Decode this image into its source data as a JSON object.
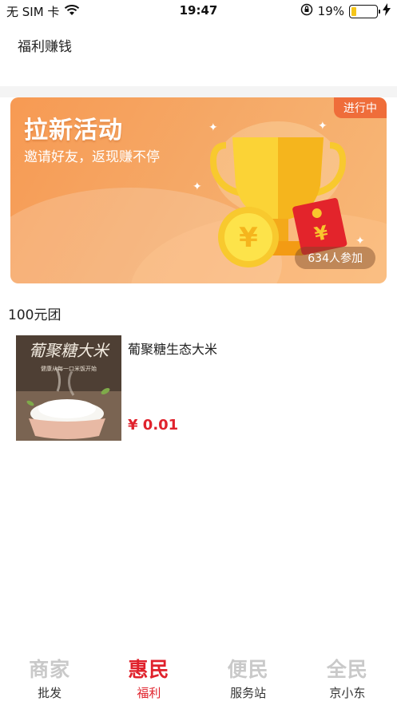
{
  "status_bar": {
    "carrier": "无 SIM 卡",
    "time": "19:47",
    "battery_percent": "19%",
    "battery_level": 0.19,
    "battery_color": "#f5c518"
  },
  "header": {
    "title": "福利赚钱"
  },
  "banner": {
    "title": "拉新活动",
    "subtitle": "邀请好友，返现赚不停",
    "status_tag": "进行中",
    "participants": "634人参加",
    "coin_symbol": "¥",
    "accent_color": "#f79a53"
  },
  "section": {
    "title": "100元团"
  },
  "product": {
    "name": "葡聚糖生态大米",
    "price": "¥ 0.01",
    "image_title": "葡聚糖大米",
    "image_subtitle": "健康从每一口米饭开始"
  },
  "tabs": [
    {
      "icon_text": "商家",
      "label": "批发",
      "active": false
    },
    {
      "icon_text": "惠民",
      "label": "福利",
      "active": true
    },
    {
      "icon_text": "便民",
      "label": "服务站",
      "active": false
    },
    {
      "icon_text": "全民",
      "label": "京小东",
      "active": false
    }
  ],
  "colors": {
    "brand_red": "#e0222c",
    "inactive_icon": "#c9c9c9"
  }
}
